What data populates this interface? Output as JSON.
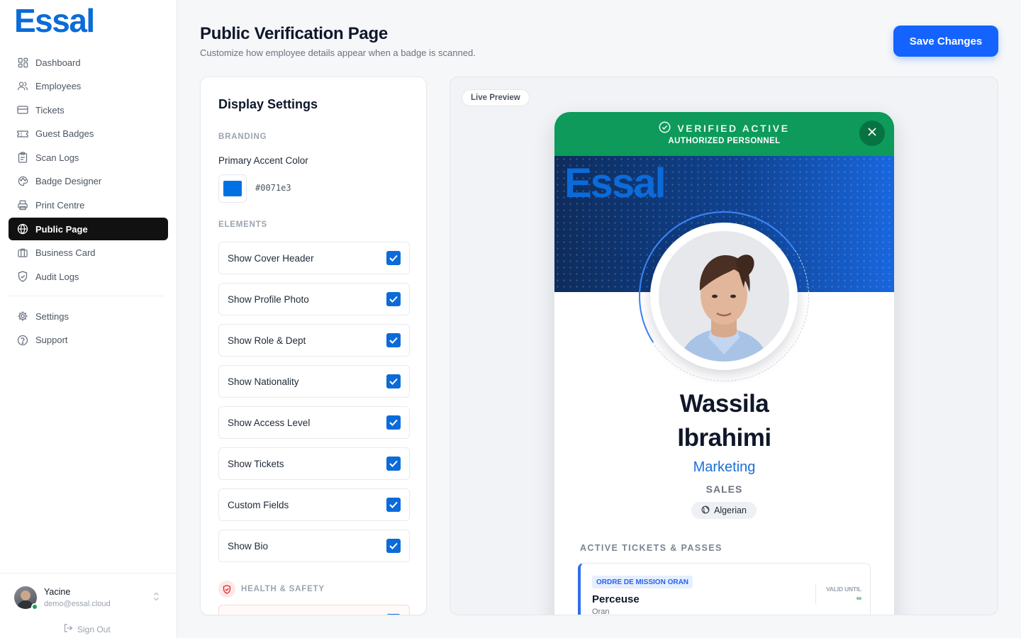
{
  "brand": {
    "logo": "Essal",
    "accent": "#0b6bd9"
  },
  "sidebar": {
    "items": [
      {
        "label": "Dashboard",
        "icon": "dashboard-grid-icon"
      },
      {
        "label": "Employees",
        "icon": "users-icon"
      },
      {
        "label": "Tickets",
        "icon": "ticket-icon"
      },
      {
        "label": "Guest Badges",
        "icon": "badge-icon"
      },
      {
        "label": "Scan Logs",
        "icon": "clipboard-icon"
      },
      {
        "label": "Badge Designer",
        "icon": "palette-icon"
      },
      {
        "label": "Print Centre",
        "icon": "printer-icon"
      },
      {
        "label": "Public Page",
        "icon": "globe-icon",
        "active": true
      },
      {
        "label": "Business Card",
        "icon": "briefcase-icon"
      },
      {
        "label": "Audit Logs",
        "icon": "shield-icon"
      }
    ],
    "secondary": [
      {
        "label": "Settings",
        "icon": "gear-icon"
      },
      {
        "label": "Support",
        "icon": "help-circle-icon"
      }
    ],
    "user": {
      "name": "Yacine",
      "email": "demo@essal.cloud",
      "status_color": "#16a34a"
    },
    "signout_label": "Sign Out"
  },
  "header": {
    "title": "Public Verification Page",
    "subtitle": "Customize how employee details appear when a badge is scanned.",
    "save_label": "Save Changes"
  },
  "settings": {
    "title": "Display Settings",
    "branding_label": "BRANDING",
    "accent_label": "Primary Accent Color",
    "accent_hex": "#0071e3",
    "elements_label": "ELEMENTS",
    "toggles": [
      {
        "label": "Show Cover Header",
        "checked": true
      },
      {
        "label": "Show Profile Photo",
        "checked": true
      },
      {
        "label": "Show Role & Dept",
        "checked": true
      },
      {
        "label": "Show Nationality",
        "checked": true
      },
      {
        "label": "Show Access Level",
        "checked": true
      },
      {
        "label": "Show Tickets",
        "checked": true
      },
      {
        "label": "Custom Fields",
        "checked": true
      },
      {
        "label": "Show Bio",
        "checked": true
      }
    ],
    "health_label": "HEALTH & SAFETY"
  },
  "preview": {
    "live_label": "Live Preview",
    "status_title": "VERIFIED ACTIVE",
    "status_sub": "AUTHORIZED PERSONNEL",
    "status_color": "#0d9a5a",
    "cover_logo": "Essal",
    "name_first": "Wassila",
    "name_last": "Ibrahimi",
    "role": "Marketing",
    "department": "SALES",
    "nationality": "Algerian",
    "tickets_label": "ACTIVE TICKETS & PASSES",
    "ticket": {
      "tag": "ORDRE DE MISSION ORAN",
      "title": "Perceuse",
      "location": "Oran",
      "valid_label": "VALID UNTIL",
      "valid_value": "∞"
    }
  }
}
